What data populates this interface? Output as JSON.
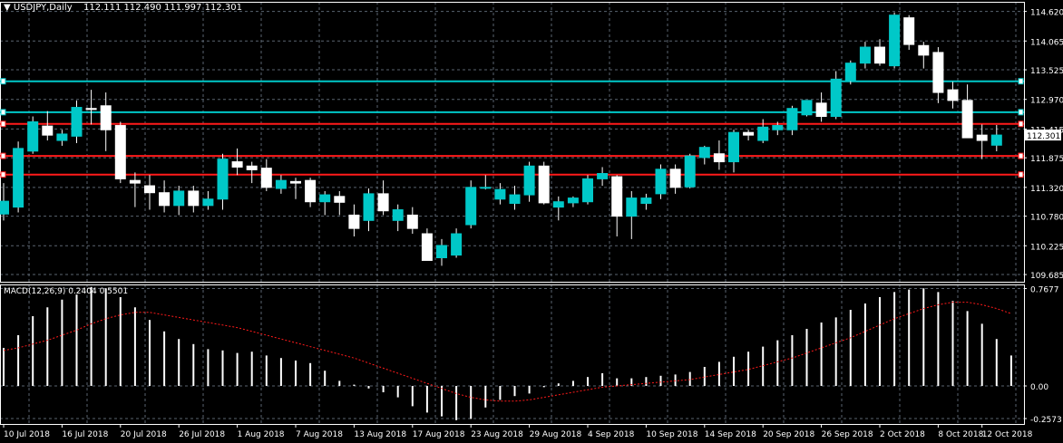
{
  "header": {
    "symbol": "USDJPY,Daily",
    "ohlc": "112.111 112.490 111.997 112.301"
  },
  "macd_header": {
    "label": "MACD(12,26,9) 0.2404 0.5501"
  },
  "colors": {
    "background": "#000000",
    "grid": "#5a6470",
    "bull_body": "#00c8c8",
    "bear_body": "#ffffff",
    "cyan_line": "#00c8c8",
    "red_line": "#ff1a1a",
    "axis_text": "#ffffff",
    "macd_hist": "#ffffff",
    "macd_signal": "#ff1a1a",
    "price_badge_bg": "#ffffff",
    "price_badge_text": "#000000"
  },
  "chart_data": [
    {
      "type": "candlestick",
      "title": "USDJPY,Daily",
      "ylim": [
        109.55,
        114.8
      ],
      "y_ticks": [
        "114.620",
        "114.065",
        "113.525",
        "112.970",
        "112.415",
        "111.875",
        "111.320",
        "110.780",
        "110.225",
        "109.685"
      ],
      "y_tick_values": [
        114.62,
        114.065,
        113.525,
        112.97,
        112.415,
        111.875,
        111.32,
        110.78,
        110.225,
        109.685
      ],
      "current_price_label": "112.301",
      "current_price": 112.301,
      "horizontal_lines": [
        {
          "color": "cyan",
          "price": 113.31
        },
        {
          "color": "cyan",
          "price": 112.73
        },
        {
          "color": "red",
          "price": 112.51
        },
        {
          "color": "red",
          "price": 111.91
        },
        {
          "color": "red",
          "price": 111.56
        }
      ],
      "x_tick_labels": [
        "10 Jul 2018",
        "16 Jul 2018",
        "20 Jul 2018",
        "26 Jul 2018",
        "1 Aug 2018",
        "7 Aug 2018",
        "13 Aug 2018",
        "17 Aug 2018",
        "23 Aug 2018",
        "29 Aug 2018",
        "4 Sep 2018",
        "10 Sep 2018",
        "14 Sep 2018",
        "20 Sep 2018",
        "26 Sep 2018",
        "2 Oct 2018",
        "8 Oct 2018",
        "12 Oct 2018"
      ],
      "x_tick_bar_index": [
        0,
        4,
        8,
        12,
        16,
        20,
        24,
        28,
        32,
        36,
        40,
        44,
        48,
        52,
        56,
        60,
        64,
        67
      ],
      "candles": [
        {
          "o": 110.82,
          "h": 111.4,
          "l": 110.7,
          "c": 111.06
        },
        {
          "o": 110.95,
          "h": 112.18,
          "l": 110.85,
          "c": 112.05
        },
        {
          "o": 112.0,
          "h": 112.65,
          "l": 111.95,
          "c": 112.55
        },
        {
          "o": 112.47,
          "h": 112.75,
          "l": 112.2,
          "c": 112.3
        },
        {
          "o": 112.2,
          "h": 112.4,
          "l": 112.1,
          "c": 112.32
        },
        {
          "o": 112.28,
          "h": 112.95,
          "l": 112.15,
          "c": 112.82
        },
        {
          "o": 112.8,
          "h": 113.15,
          "l": 112.5,
          "c": 112.78
        },
        {
          "o": 112.85,
          "h": 113.1,
          "l": 112.0,
          "c": 112.4
        },
        {
          "o": 112.48,
          "h": 112.55,
          "l": 111.4,
          "c": 111.48
        },
        {
          "o": 111.45,
          "h": 111.6,
          "l": 110.95,
          "c": 111.4
        },
        {
          "o": 111.35,
          "h": 111.55,
          "l": 110.9,
          "c": 111.22
        },
        {
          "o": 111.22,
          "h": 111.45,
          "l": 110.85,
          "c": 110.98
        },
        {
          "o": 110.98,
          "h": 111.35,
          "l": 110.8,
          "c": 111.25
        },
        {
          "o": 111.25,
          "h": 111.35,
          "l": 110.85,
          "c": 110.98
        },
        {
          "o": 110.98,
          "h": 111.25,
          "l": 110.9,
          "c": 111.1
        },
        {
          "o": 111.1,
          "h": 111.95,
          "l": 110.9,
          "c": 111.85
        },
        {
          "o": 111.8,
          "h": 112.05,
          "l": 111.55,
          "c": 111.7
        },
        {
          "o": 111.72,
          "h": 111.8,
          "l": 111.4,
          "c": 111.65
        },
        {
          "o": 111.68,
          "h": 111.85,
          "l": 111.25,
          "c": 111.32
        },
        {
          "o": 111.3,
          "h": 111.55,
          "l": 111.2,
          "c": 111.45
        },
        {
          "o": 111.43,
          "h": 111.5,
          "l": 111.1,
          "c": 111.4
        },
        {
          "o": 111.45,
          "h": 111.5,
          "l": 110.95,
          "c": 111.05
        },
        {
          "o": 111.05,
          "h": 111.25,
          "l": 110.8,
          "c": 111.18
        },
        {
          "o": 111.15,
          "h": 111.25,
          "l": 110.8,
          "c": 111.04
        },
        {
          "o": 110.8,
          "h": 111.0,
          "l": 110.4,
          "c": 110.55
        },
        {
          "o": 110.7,
          "h": 111.3,
          "l": 110.5,
          "c": 111.2
        },
        {
          "o": 111.2,
          "h": 111.45,
          "l": 110.8,
          "c": 110.88
        },
        {
          "o": 110.7,
          "h": 111.0,
          "l": 110.5,
          "c": 110.9
        },
        {
          "o": 110.8,
          "h": 110.95,
          "l": 110.45,
          "c": 110.55
        },
        {
          "o": 110.45,
          "h": 110.55,
          "l": 109.95,
          "c": 109.95
        },
        {
          "o": 110.0,
          "h": 110.35,
          "l": 109.85,
          "c": 110.23
        },
        {
          "o": 110.05,
          "h": 110.55,
          "l": 110.0,
          "c": 110.45
        },
        {
          "o": 110.62,
          "h": 111.45,
          "l": 110.55,
          "c": 111.32
        },
        {
          "o": 111.32,
          "h": 111.55,
          "l": 111.28,
          "c": 111.32
        },
        {
          "o": 111.1,
          "h": 111.4,
          "l": 111.0,
          "c": 111.28
        },
        {
          "o": 111.02,
          "h": 111.35,
          "l": 110.9,
          "c": 111.18
        },
        {
          "o": 111.18,
          "h": 111.8,
          "l": 111.05,
          "c": 111.72
        },
        {
          "o": 111.72,
          "h": 111.8,
          "l": 111.0,
          "c": 111.03
        },
        {
          "o": 110.95,
          "h": 111.15,
          "l": 110.7,
          "c": 111.05
        },
        {
          "o": 111.03,
          "h": 111.15,
          "l": 110.95,
          "c": 111.12
        },
        {
          "o": 111.05,
          "h": 111.55,
          "l": 111.0,
          "c": 111.48
        },
        {
          "o": 111.48,
          "h": 111.7,
          "l": 111.35,
          "c": 111.58
        },
        {
          "o": 111.52,
          "h": 111.55,
          "l": 110.4,
          "c": 110.78
        },
        {
          "o": 110.78,
          "h": 111.25,
          "l": 110.35,
          "c": 111.12
        },
        {
          "o": 111.02,
          "h": 111.2,
          "l": 110.9,
          "c": 111.12
        },
        {
          "o": 111.2,
          "h": 111.75,
          "l": 111.1,
          "c": 111.66
        },
        {
          "o": 111.66,
          "h": 111.75,
          "l": 111.2,
          "c": 111.32
        },
        {
          "o": 111.33,
          "h": 111.95,
          "l": 111.3,
          "c": 111.91
        },
        {
          "o": 111.88,
          "h": 112.1,
          "l": 111.75,
          "c": 112.07
        },
        {
          "o": 111.95,
          "h": 112.2,
          "l": 111.65,
          "c": 111.8
        },
        {
          "o": 111.8,
          "h": 112.4,
          "l": 111.6,
          "c": 112.35
        },
        {
          "o": 112.35,
          "h": 112.4,
          "l": 112.2,
          "c": 112.3
        },
        {
          "o": 112.2,
          "h": 112.6,
          "l": 112.15,
          "c": 112.45
        },
        {
          "o": 112.4,
          "h": 112.55,
          "l": 112.3,
          "c": 112.48
        },
        {
          "o": 112.4,
          "h": 112.85,
          "l": 112.3,
          "c": 112.8
        },
        {
          "o": 112.68,
          "h": 112.95,
          "l": 112.65,
          "c": 112.95
        },
        {
          "o": 112.9,
          "h": 113.1,
          "l": 112.55,
          "c": 112.65
        },
        {
          "o": 112.65,
          "h": 113.5,
          "l": 112.6,
          "c": 113.35
        },
        {
          "o": 113.32,
          "h": 113.7,
          "l": 113.25,
          "c": 113.65
        },
        {
          "o": 113.65,
          "h": 114.05,
          "l": 113.55,
          "c": 113.95
        },
        {
          "o": 113.95,
          "h": 114.1,
          "l": 113.6,
          "c": 113.65
        },
        {
          "o": 113.6,
          "h": 114.6,
          "l": 113.55,
          "c": 114.55
        },
        {
          "o": 114.5,
          "h": 114.55,
          "l": 113.9,
          "c": 114.0
        },
        {
          "o": 113.98,
          "h": 114.05,
          "l": 113.55,
          "c": 113.8
        },
        {
          "o": 113.85,
          "h": 113.95,
          "l": 112.9,
          "c": 113.1
        },
        {
          "o": 113.15,
          "h": 113.3,
          "l": 112.8,
          "c": 112.95
        },
        {
          "o": 112.95,
          "h": 113.25,
          "l": 112.25,
          "c": 112.25
        },
        {
          "o": 112.3,
          "h": 112.5,
          "l": 111.85,
          "c": 112.2
        },
        {
          "o": 112.111,
          "h": 112.49,
          "l": 111.997,
          "c": 112.301
        }
      ]
    },
    {
      "type": "bar",
      "title": "MACD(12,26,9) 0.2404 0.5501",
      "ylim": [
        -0.3,
        0.8
      ],
      "y_ticks": [
        "0.7677",
        "0.00",
        "-0.2573"
      ],
      "y_tick_values": [
        0.7677,
        0.0,
        -0.2573
      ],
      "series": [
        {
          "name": "MACD",
          "style": "histogram",
          "values": [
            0.3,
            0.4,
            0.55,
            0.62,
            0.68,
            0.72,
            0.78,
            0.77,
            0.7,
            0.62,
            0.52,
            0.43,
            0.37,
            0.33,
            0.29,
            0.28,
            0.26,
            0.27,
            0.24,
            0.22,
            0.2,
            0.18,
            0.12,
            0.04,
            0.01,
            -0.02,
            -0.05,
            -0.09,
            -0.16,
            -0.21,
            -0.24,
            -0.27,
            -0.26,
            -0.17,
            -0.11,
            -0.08,
            -0.06,
            -0.01,
            0.02,
            0.04,
            0.07,
            0.1,
            0.06,
            0.06,
            0.07,
            0.08,
            0.09,
            0.11,
            0.15,
            0.19,
            0.23,
            0.27,
            0.31,
            0.36,
            0.4,
            0.45,
            0.5,
            0.54,
            0.6,
            0.65,
            0.7,
            0.74,
            0.76,
            0.77,
            0.74,
            0.67,
            0.59,
            0.49,
            0.37,
            0.24
          ]
        },
        {
          "name": "Signal",
          "style": "dotted-line",
          "values": [
            0.28,
            0.3,
            0.33,
            0.36,
            0.4,
            0.44,
            0.49,
            0.53,
            0.56,
            0.58,
            0.58,
            0.56,
            0.54,
            0.52,
            0.5,
            0.48,
            0.46,
            0.43,
            0.4,
            0.37,
            0.34,
            0.31,
            0.28,
            0.25,
            0.22,
            0.18,
            0.14,
            0.1,
            0.06,
            0.02,
            -0.02,
            -0.06,
            -0.09,
            -0.11,
            -0.12,
            -0.12,
            -0.11,
            -0.09,
            -0.07,
            -0.05,
            -0.03,
            -0.01,
            0.0,
            0.01,
            0.02,
            0.03,
            0.04,
            0.05,
            0.07,
            0.09,
            0.11,
            0.13,
            0.16,
            0.19,
            0.22,
            0.26,
            0.3,
            0.34,
            0.38,
            0.43,
            0.48,
            0.53,
            0.57,
            0.61,
            0.64,
            0.66,
            0.66,
            0.64,
            0.61,
            0.57
          ]
        }
      ]
    }
  ]
}
